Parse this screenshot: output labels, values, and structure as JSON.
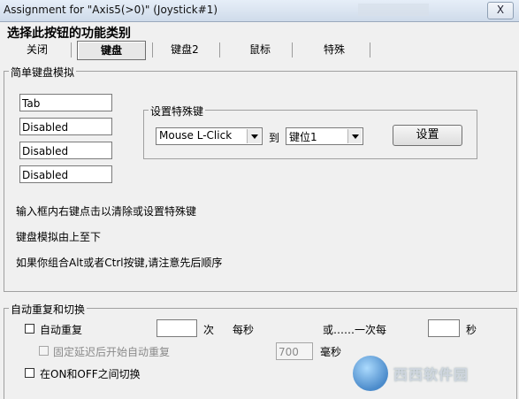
{
  "window": {
    "title": "Assignment for \"Axis5(>0)\" (Joystick#1)",
    "close_glyph": "X"
  },
  "heading": "选择此按钮的功能类别",
  "tabs": [
    {
      "label": "关闭"
    },
    {
      "label": "键盘"
    },
    {
      "label": "键盘2"
    },
    {
      "label": "鼠标"
    },
    {
      "label": "特殊"
    }
  ],
  "keyboard_group": {
    "label": "简单键盘模拟",
    "key_inputs": [
      "Tab",
      "Disabled",
      "Disabled",
      "Disabled"
    ],
    "special_group": {
      "label": "设置特殊键",
      "mouse_select": "Mouse L-Click",
      "to_label": "到",
      "slot_select": "键位1",
      "set_button": "设置"
    },
    "notes": [
      "输入框内右键点击以清除或设置特殊键",
      "键盘模拟由上至下",
      "如果你组合Alt或者Ctrl按键,请注意先后顺序"
    ]
  },
  "repeat_group": {
    "label": "自动重复和切换",
    "auto_repeat_label": "自动重复",
    "times_value": "",
    "times_unit": "次",
    "per_second": "每秒",
    "or_once_every": "或……一次每",
    "seconds_value": "",
    "seconds_unit": "秒",
    "delayed_label": "固定延迟后开始自动重复",
    "delay_value": "700",
    "delay_unit": "毫秒",
    "toggle_label": "在ON和OFF之间切换"
  },
  "watermark": {
    "text": "西西软件园"
  }
}
